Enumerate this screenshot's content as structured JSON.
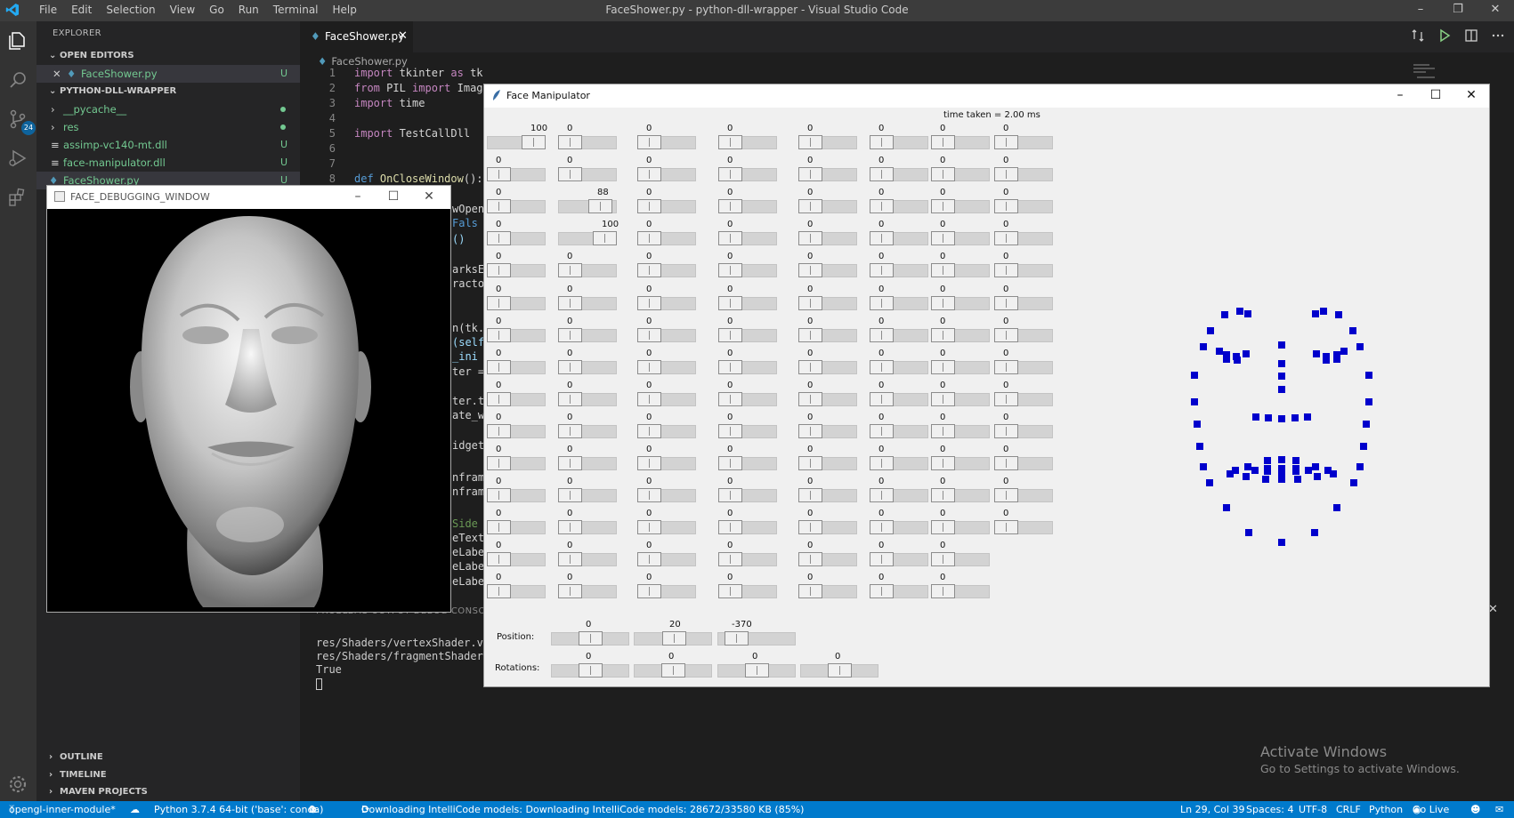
{
  "titlebar": {
    "menu": [
      "File",
      "Edit",
      "Selection",
      "View",
      "Go",
      "Run",
      "Terminal",
      "Help"
    ],
    "title": "FaceShower.py - python-dll-wrapper - Visual Studio Code"
  },
  "activitybar": {
    "scm_badge": "24"
  },
  "sidebar": {
    "header": "EXPLORER",
    "open_editors": "OPEN EDITORS",
    "open_file": "FaceShower.py",
    "open_file_status": "U",
    "project": "PYTHON-DLL-WRAPPER",
    "files": [
      {
        "name": "__pycache__",
        "status": ""
      },
      {
        "name": "res",
        "status": ""
      },
      {
        "name": "assimp-vc140-mt.dll",
        "status": "U"
      },
      {
        "name": "face-manipulator.dll",
        "status": "U"
      },
      {
        "name": "FaceShower.py",
        "status": "U"
      }
    ],
    "outline": "OUTLINE",
    "timeline": "TIMELINE",
    "maven": "MAVEN PROJECTS"
  },
  "editor": {
    "tab": "FaceShower.py",
    "breadcrumb": "FaceShower.py",
    "line_numbers": [
      "1",
      "2",
      "3",
      "4",
      "5",
      "6",
      "7",
      "8"
    ],
    "partial_code": [
      "wOpen",
      "Fals",
      "()",
      "arksE",
      "racto",
      "n(tk.",
      "(self",
      "_ini",
      "ter =",
      "ter.t",
      "ate_w",
      "idget",
      "nfram",
      "nfram",
      "Side",
      "eText",
      "eLabe",
      "eLabe",
      "eLabe"
    ]
  },
  "terminal": {
    "tabs_partial": "PROBLEMS   OUTPUT   DEBUG CONSOLE",
    "lines": [
      "res/Shaders/vertexShader.vs",
      "res/Shaders/fragmentShader.fs",
      "True"
    ]
  },
  "statusbar": {
    "branch": "opengl-inner-module*",
    "interpreter": "Python 3.7.4 64-bit ('base': conda)",
    "errors": "0",
    "warnings": "0",
    "message": "Downloading IntelliCode models: Downloading IntelliCode models: 28672/33580 KB (85%)",
    "position": "Ln 29, Col 39",
    "spaces": "Spaces: 4",
    "encoding": "UTF-8",
    "eol": "CRLF",
    "language": "Python",
    "golive": "Go Live"
  },
  "activate": {
    "title": "Activate Windows",
    "subtitle": "Go to Settings to activate Windows."
  },
  "face_debug_window": {
    "title": "FACE_DEBUGGING_WINDOW"
  },
  "face_manipulator": {
    "title": "Face Manipulator",
    "time_taken": "time taken = 2.00 ms",
    "slider_rows": [
      [
        100,
        0,
        0,
        0,
        0,
        0,
        0,
        0
      ],
      [
        0,
        0,
        0,
        0,
        0,
        0,
        0,
        0
      ],
      [
        0,
        88,
        0,
        0,
        0,
        0,
        0,
        0
      ],
      [
        0,
        100,
        0,
        0,
        0,
        0,
        0,
        0
      ],
      [
        0,
        0,
        0,
        0,
        0,
        0,
        0,
        0
      ],
      [
        0,
        0,
        0,
        0,
        0,
        0,
        0,
        0
      ],
      [
        0,
        0,
        0,
        0,
        0,
        0,
        0,
        0
      ],
      [
        0,
        0,
        0,
        0,
        0,
        0,
        0,
        0
      ],
      [
        0,
        0,
        0,
        0,
        0,
        0,
        0,
        0
      ],
      [
        0,
        0,
        0,
        0,
        0,
        0,
        0,
        0
      ],
      [
        0,
        0,
        0,
        0,
        0,
        0,
        0,
        0
      ],
      [
        0,
        0,
        0,
        0,
        0,
        0,
        0,
        0
      ],
      [
        0,
        0,
        0,
        0,
        0,
        0,
        0,
        0
      ],
      [
        0,
        0,
        0,
        0,
        0,
        0,
        0
      ],
      [
        0,
        0,
        0,
        0,
        0,
        0,
        0
      ]
    ],
    "position_label": "Position:",
    "position_values": [
      0,
      20,
      -370
    ],
    "rotations_label": "Rotations:",
    "rotation_values": [
      0,
      0,
      0,
      0
    ],
    "landmark_color": "#0000cc"
  }
}
